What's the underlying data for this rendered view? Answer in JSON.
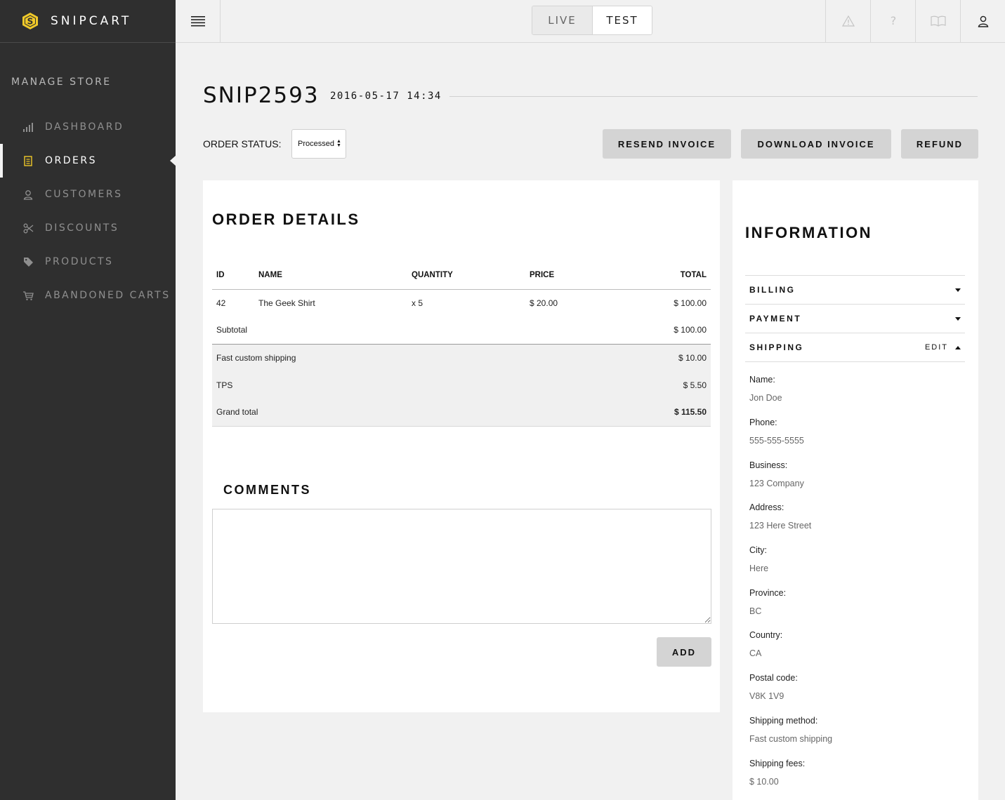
{
  "brand": {
    "name": "SNIPCART"
  },
  "sidebar": {
    "section_title": "MANAGE STORE",
    "items": [
      {
        "label": "DASHBOARD",
        "icon": "bar-chart-icon"
      },
      {
        "label": "ORDERS",
        "icon": "receipt-icon",
        "active": true
      },
      {
        "label": "CUSTOMERS",
        "icon": "user-icon"
      },
      {
        "label": "DISCOUNTS",
        "icon": "scissors-icon"
      },
      {
        "label": "PRODUCTS",
        "icon": "tag-icon"
      },
      {
        "label": "ABANDONED CARTS",
        "icon": "cart-icon"
      }
    ]
  },
  "topbar": {
    "modes": [
      "LIVE",
      "TEST"
    ],
    "active_mode": "TEST",
    "icons": [
      "warning-icon",
      "help-icon",
      "book-icon",
      "account-icon"
    ]
  },
  "order": {
    "id": "SNIP2593",
    "date": "2016-05-17 14:34",
    "status_label": "ORDER STATUS:",
    "status_value": "Processed",
    "actions": [
      "RESEND INVOICE",
      "DOWNLOAD INVOICE",
      "REFUND"
    ]
  },
  "details": {
    "title": "ORDER DETAILS",
    "columns": [
      "ID",
      "NAME",
      "QUANTITY",
      "PRICE",
      "TOTAL"
    ],
    "rows": [
      {
        "id": "42",
        "name": "The Geek Shirt",
        "quantity": "x 5",
        "price": "$ 20.00",
        "total": "$ 100.00"
      }
    ],
    "subtotal_label": "Subtotal",
    "subtotal_value": "$ 100.00",
    "shipping_label": "Fast custom shipping",
    "shipping_value": "$ 10.00",
    "tax_label": "TPS",
    "tax_value": "$ 5.50",
    "grand_label": "Grand total",
    "grand_value": "$ 115.50"
  },
  "comments": {
    "title": "COMMENTS",
    "value": "",
    "add_label": "ADD"
  },
  "information": {
    "title": "INFORMATION",
    "sections": [
      {
        "label": "BILLING",
        "expanded": false
      },
      {
        "label": "PAYMENT",
        "expanded": false
      },
      {
        "label": "SHIPPING",
        "expanded": true,
        "edit_label": "EDIT"
      }
    ],
    "shipping_fields": [
      {
        "label": "Name:",
        "value": "Jon Doe"
      },
      {
        "label": "Phone:",
        "value": "555-555-5555"
      },
      {
        "label": "Business:",
        "value": "123 Company"
      },
      {
        "label": "Address:",
        "value": "123 Here Street"
      },
      {
        "label": "City:",
        "value": "Here"
      },
      {
        "label": "Province:",
        "value": "BC"
      },
      {
        "label": "Country:",
        "value": "CA"
      },
      {
        "label": "Postal code:",
        "value": "V8K 1V9"
      },
      {
        "label": "Shipping method:",
        "value": "Fast custom shipping"
      },
      {
        "label": "Shipping fees:",
        "value": "$ 10.00"
      }
    ]
  },
  "colors": {
    "sidebar_bg": "#2f2f2f",
    "brand_yellow": "#f0c929",
    "page_bg": "#f1f1f1"
  }
}
